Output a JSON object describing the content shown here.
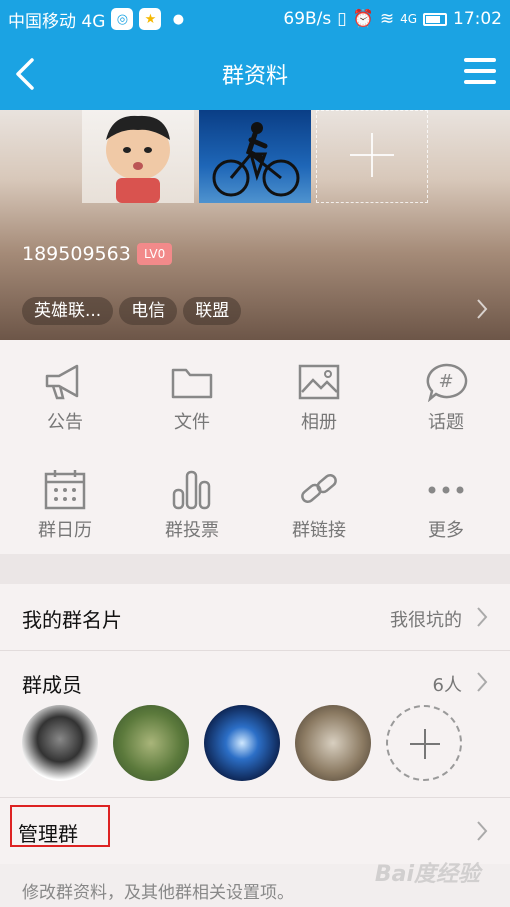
{
  "status_bar": {
    "carrier": "中国移动 4G",
    "speed": "69B/s",
    "network": "4G",
    "time": "17:02"
  },
  "header": {
    "title": "群资料"
  },
  "group": {
    "id": "189509563",
    "level": "LV0",
    "tags": [
      "英雄联...",
      "电信",
      "联盟"
    ]
  },
  "grid": {
    "items": [
      {
        "label": "公告",
        "icon": "megaphone-icon"
      },
      {
        "label": "文件",
        "icon": "folder-icon"
      },
      {
        "label": "相册",
        "icon": "image-icon"
      },
      {
        "label": "话题",
        "icon": "hashtag-bubble-icon"
      },
      {
        "label": "群日历",
        "icon": "calendar-icon"
      },
      {
        "label": "群投票",
        "icon": "poll-bars-icon"
      },
      {
        "label": "群链接",
        "icon": "link-icon"
      },
      {
        "label": "更多",
        "icon": "more-dots-icon"
      }
    ]
  },
  "card": {
    "label": "我的群名片",
    "value": "我很坑的"
  },
  "members": {
    "label": "群成员",
    "count": "6人"
  },
  "manage": {
    "label": "管理群",
    "hint": "修改群资料，及其他群相关设置项。"
  },
  "watermark": "Bai度经验",
  "colors": {
    "accent": "#1ba3e3",
    "badge": "#f28a8a",
    "highlight_box": "#dd2222"
  }
}
